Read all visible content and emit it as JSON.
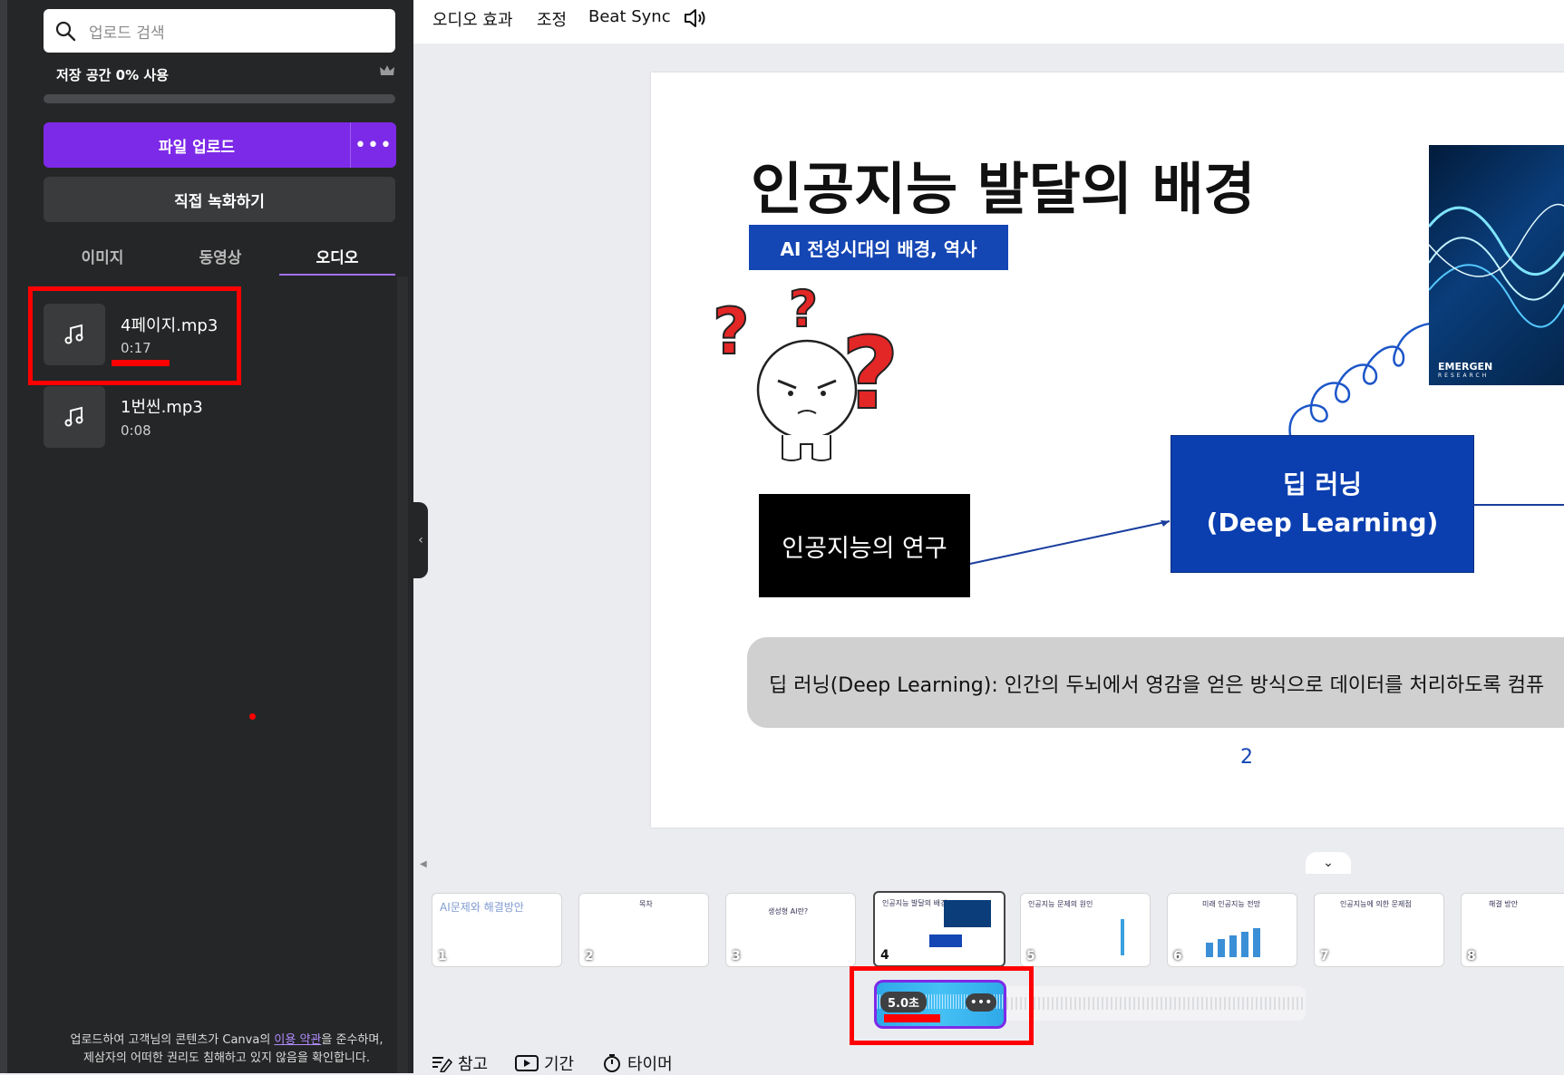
{
  "sidebar": {
    "search_placeholder": "업로드 검색",
    "storage_label": "저장 공간 0% 사용",
    "storage_percent": 0,
    "upload_button": "파일 업로드",
    "upload_more": "•••",
    "record_button": "직접 녹화하기",
    "tabs": [
      {
        "label": "이미지"
      },
      {
        "label": "동영상"
      },
      {
        "label": "오디오"
      }
    ],
    "active_tab": "오디오",
    "audio_files": [
      {
        "name": "4페이지.mp3",
        "duration": "0:17"
      },
      {
        "name": "1번씬.mp3",
        "duration": "0:08"
      }
    ],
    "legal_line1_pre": "업로드하여 고객님의 콘텐츠가 Canva의 ",
    "legal_link": "이용 약관",
    "legal_line1_post": "을 준수하며,",
    "legal_line2": "제삼자의 어떠한 권리도 침해하고 있지 않음을 확인합니다."
  },
  "toolbar": {
    "audio_effects": "오디오 효과",
    "adjust": "조정",
    "beat_sync": "Beat Sync"
  },
  "slide": {
    "title": "인공지능 발달의 배경",
    "subtitle": "AI 전성시대의 배경, 역사",
    "black_box": "인공지능의 연구",
    "blue_box_line1": "딥 러닝",
    "blue_box_line2": "(Deep Learning)",
    "caption": "딥 러닝(Deep Learning): 인간의 두뇌에서 영감을 얻은 방식으로 데이터를 처리하도록 컴퓨",
    "page_number": "2",
    "photo_logo": "EMERGEN",
    "photo_logo_sub": "RESEARCH"
  },
  "thumbnails": [
    {
      "num": "1",
      "title": "AI문제와 해결방안"
    },
    {
      "num": "2",
      "title": "목차"
    },
    {
      "num": "3",
      "title": "생성형 AI란?"
    },
    {
      "num": "4",
      "title": "인공지능 발달의 배경"
    },
    {
      "num": "5",
      "title": "인공지능 문제의 원인"
    },
    {
      "num": "6",
      "title": "미래 인공지능 전망"
    },
    {
      "num": "7",
      "title": "인공지능에 의한 문제점"
    },
    {
      "num": "8",
      "title": "해결 방안"
    }
  ],
  "selected_thumbnail": "4",
  "audio_clip": {
    "duration": "5.0초",
    "more": "•••"
  },
  "bottom_bar": {
    "notes": "참고",
    "duration": "기간",
    "timer": "타이머"
  },
  "colors": {
    "accent": "#7d2ae8",
    "slide_blue": "#1446b4",
    "annotation_red": "#ff0000",
    "audio_clip": "#2fa8e8"
  }
}
